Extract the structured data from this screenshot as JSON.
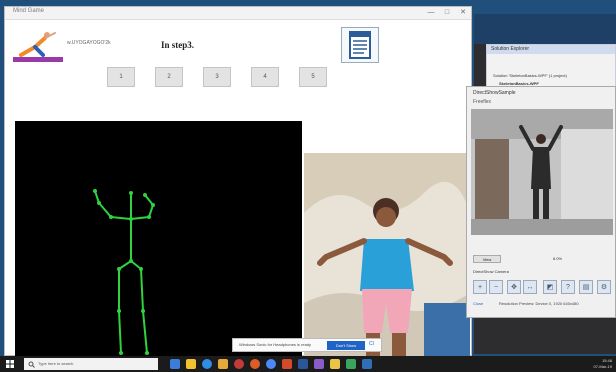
{
  "app": {
    "title": "Mind Game",
    "window_controls": [
      "—",
      "□",
      "✕"
    ],
    "pose_label": "w.UYOGAYOGO'2k",
    "step_text": "In step3.",
    "step_buttons": [
      "1",
      "2",
      "3",
      "4",
      "5"
    ]
  },
  "toast": {
    "message": "Windows Sonic for Headphones is ready",
    "action": "Don't Show",
    "close": "Cl"
  },
  "solution_explorer": {
    "header": "Solution Explorer",
    "lines": [
      "Solution 'SkeletonBasics-WPF' (1 project)",
      "SkeletonBasics-WPF"
    ]
  },
  "camera_dialog": {
    "title": "DirectShowSample",
    "subtitle": "Freeflex",
    "button": "View",
    "zoom": "8.0%",
    "controls_label": "DirectShow Camera",
    "link": "Close",
    "status": "Resolution Preview: Device 0, 1920 640x480"
  },
  "taskbar": {
    "search_placeholder": "Type here to search",
    "clock_time": "15:48",
    "clock_date": "07-Mar-19"
  },
  "colors": {
    "skeleton": "#2fd23f",
    "accent": "#1f63c6"
  }
}
